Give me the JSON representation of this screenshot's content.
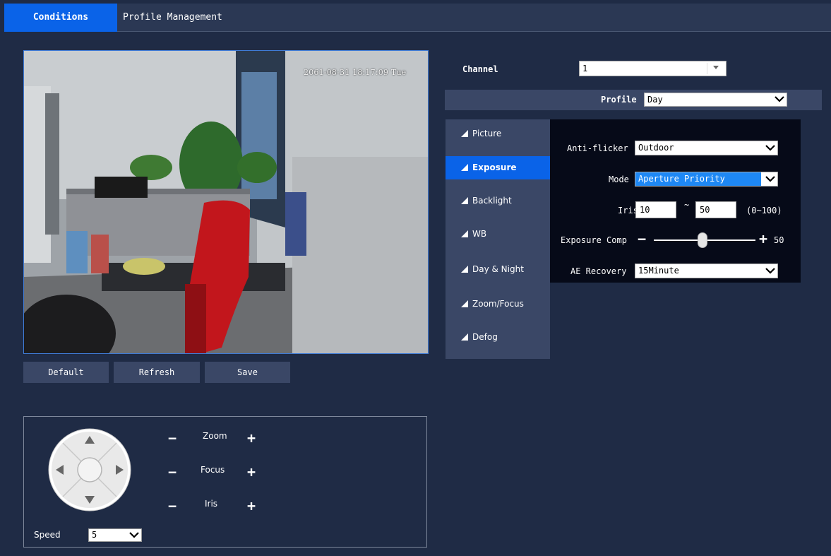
{
  "tabs": [
    {
      "label": "Conditions"
    },
    {
      "label": "Profile Management"
    }
  ],
  "video": {
    "osd_time": "2061-08-31 18:17:09 Tue"
  },
  "buttons": {
    "default": "Default",
    "refresh": "Refresh",
    "save": "Save"
  },
  "ptz": {
    "zoom": "Zoom",
    "focus": "Focus",
    "iris": "Iris",
    "speed_label": "Speed",
    "speed_value": "5",
    "minus": "−",
    "plus": "+"
  },
  "channel": {
    "label": "Channel",
    "value": "1"
  },
  "profile": {
    "label": "Profile",
    "value": "Day"
  },
  "menu": [
    {
      "label": "Picture"
    },
    {
      "label": "Exposure"
    },
    {
      "label": "Backlight"
    },
    {
      "label": "WB"
    },
    {
      "label": "Day & Night"
    },
    {
      "label": "Zoom/Focus"
    },
    {
      "label": "Defog"
    }
  ],
  "exposure": {
    "anti_flicker_label": "Anti-flicker",
    "anti_flicker_value": "Outdoor",
    "mode_label": "Mode",
    "mode_value": "Aperture Priority",
    "iris_label": "Iris",
    "iris_min": "10",
    "iris_tilde": "~",
    "iris_max": "50",
    "iris_range": "(0~100)",
    "comp_label": "Exposure Comp",
    "comp_value": "50",
    "comp_minus": "−",
    "comp_plus": "+",
    "ae_label": "AE Recovery",
    "ae_value": "15Minute"
  },
  "colors": {
    "accent": "#0a63e8",
    "background": "#1f2b45",
    "panel": "#3a4766"
  }
}
